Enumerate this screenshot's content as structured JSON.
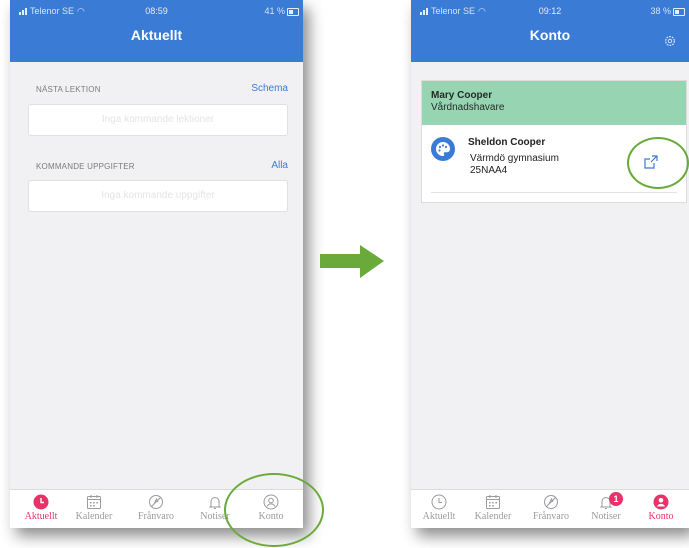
{
  "colors": {
    "accent": "#3a7bd5",
    "active": "#e8336a",
    "guardian_bg": "#97d4b1",
    "annotation": "#6aaa3a",
    "arrow": "#6aaa3a"
  },
  "left": {
    "status": {
      "carrier": "Telenor SE",
      "time": "08:59",
      "battery": "41 %"
    },
    "title": "Aktuellt",
    "next_lesson": {
      "label": "NÄSTA LEKTION",
      "link": "Schema",
      "empty": "Inga kommande lektioner"
    },
    "upcoming": {
      "label": "KOMMANDE UPPGIFTER",
      "link": "Alla",
      "empty": "Inga kommande uppgifter"
    },
    "tabs": [
      "Aktuellt",
      "Kalender",
      "Frånvaro",
      "Notiser",
      "Konto"
    ],
    "active_tab": "Aktuellt"
  },
  "right": {
    "status": {
      "carrier": "Telenor SE",
      "time": "09:12",
      "battery": "38 %"
    },
    "title": "Konto",
    "guardian": {
      "name": "Mary Cooper",
      "role": "Vårdnadshavare"
    },
    "student": {
      "name": "Sheldon Cooper",
      "school": "Värmdö gymnasium",
      "class": "25NAA4"
    },
    "tabs": [
      "Aktuellt",
      "Kalender",
      "Frånvaro",
      "Notiser",
      "Konto"
    ],
    "notification_badge": "1",
    "active_tab": "Konto"
  },
  "icons": [
    "clock-icon",
    "calendar-icon",
    "absence-icon",
    "bell-icon",
    "account-icon",
    "gear-icon",
    "palette-icon",
    "external-link-icon",
    "arrow-right-icon"
  ]
}
